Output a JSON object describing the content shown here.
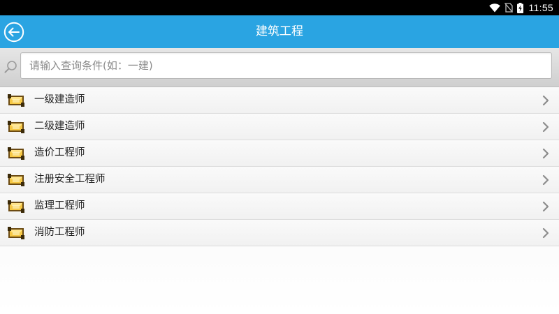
{
  "status": {
    "time": "11:55"
  },
  "header": {
    "title": "建筑工程"
  },
  "search": {
    "placeholder": "请输入查询条件(如：一建)"
  },
  "list": {
    "items": [
      {
        "label": "一级建造师"
      },
      {
        "label": "二级建造师"
      },
      {
        "label": "造价工程师"
      },
      {
        "label": "注册安全工程师"
      },
      {
        "label": "监理工程师"
      },
      {
        "label": "消防工程师"
      }
    ]
  },
  "colors": {
    "accent": "#2aa4e2",
    "statusbar": "#000000"
  },
  "icons": {
    "back": "back-arrow-circle-icon",
    "search": "search-icon",
    "item": "folder-book-icon",
    "chevron": "chevron-right-icon"
  }
}
